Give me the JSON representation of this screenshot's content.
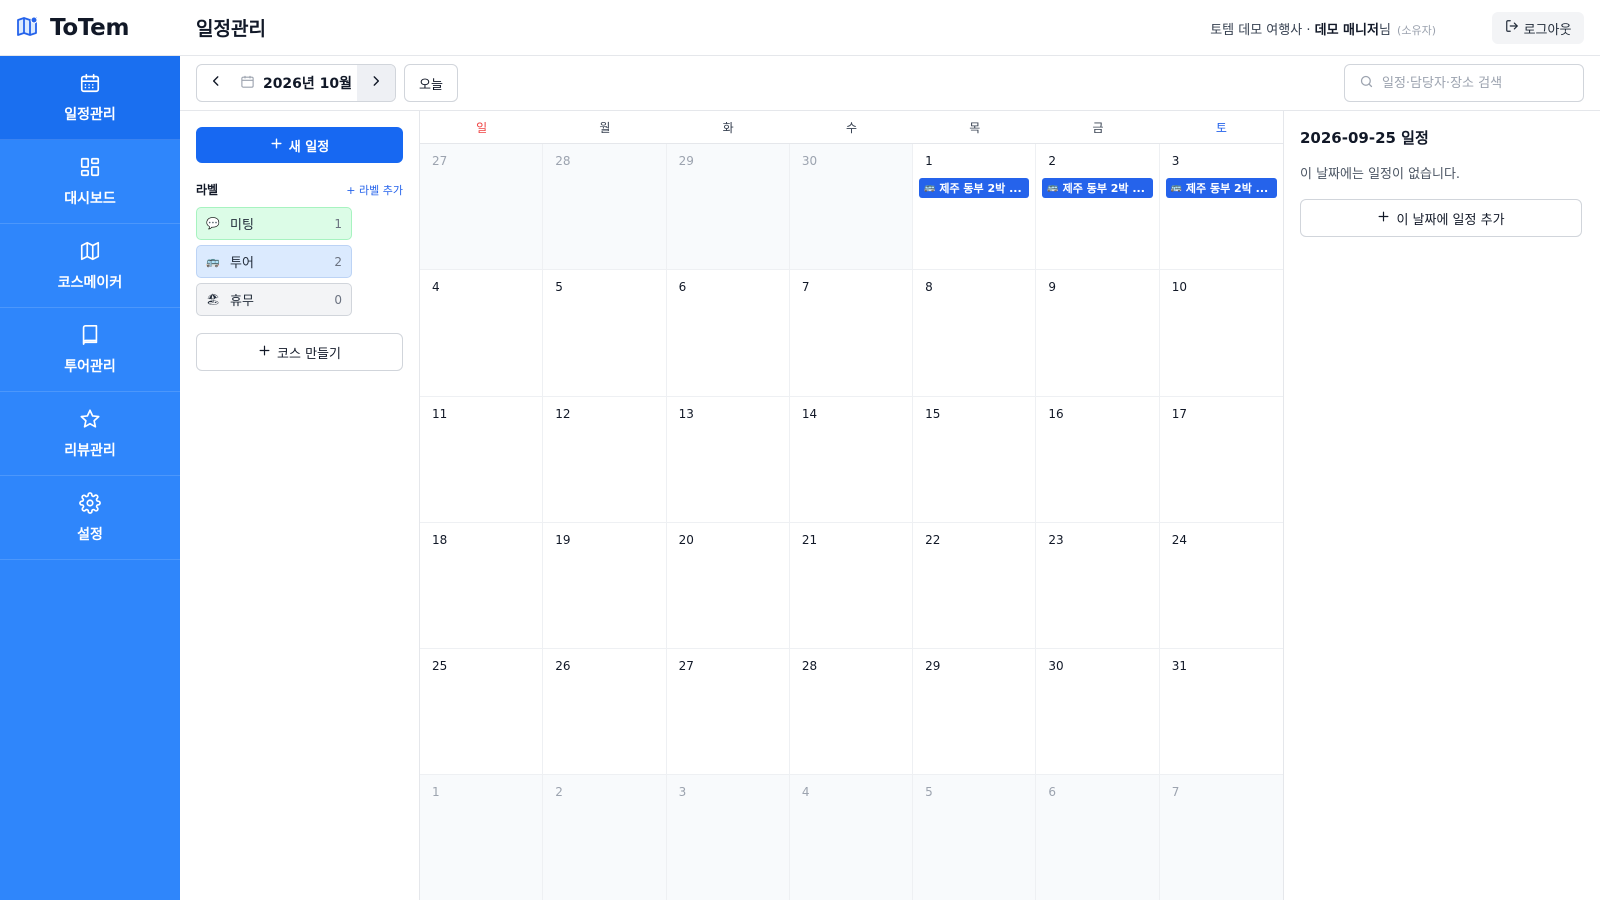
{
  "app": {
    "name": "ToTem"
  },
  "header": {
    "page_title": "일정관리",
    "company": "토템 데모 여행사",
    "separator": " · ",
    "user_name": "데모 매니저",
    "honorific": "님",
    "role": "(소유자)",
    "logout_label": "로그아웃"
  },
  "sidebar": {
    "items": [
      {
        "label": "일정관리",
        "icon": "calendar-icon",
        "active": true
      },
      {
        "label": "대시보드",
        "icon": "dashboard-icon",
        "active": false
      },
      {
        "label": "코스메이커",
        "icon": "map-icon",
        "active": false
      },
      {
        "label": "투어관리",
        "icon": "book-icon",
        "active": false
      },
      {
        "label": "리뷰관리",
        "icon": "star-icon",
        "active": false
      },
      {
        "label": "설정",
        "icon": "gear-icon",
        "active": false
      }
    ]
  },
  "toolbar": {
    "month_label": "2026년 10월",
    "today_label": "오늘",
    "search_placeholder": "일정·담당자·장소 검색"
  },
  "left_panel": {
    "new_event_label": "새 일정",
    "labels_title": "라벨",
    "add_label": "+ 라벨 추가",
    "labels": [
      {
        "emoji": "💬",
        "name": "미팅",
        "count": "1",
        "bg": "#dcfce7",
        "border": "#a7f3c0"
      },
      {
        "emoji": "🚌",
        "name": "투어",
        "count": "2",
        "bg": "#dbeafe",
        "border": "#bcd3f5"
      },
      {
        "emoji": "🏖",
        "name": "휴무",
        "count": "0",
        "bg": "#f3f4f6",
        "border": "#d1d5db"
      }
    ],
    "course_button_label": "코스 만들기"
  },
  "calendar": {
    "weekdays": [
      "일",
      "월",
      "화",
      "수",
      "목",
      "금",
      "토"
    ],
    "days": [
      {
        "n": "27",
        "other": true
      },
      {
        "n": "28",
        "other": true
      },
      {
        "n": "29",
        "other": true
      },
      {
        "n": "30",
        "other": true
      },
      {
        "n": "1",
        "event": {
          "emoji": "🚌",
          "title": "제주 동부 2박 ..."
        }
      },
      {
        "n": "2",
        "event": {
          "emoji": "🚌",
          "title": "제주 동부 2박 ..."
        }
      },
      {
        "n": "3",
        "event": {
          "emoji": "🚌",
          "title": "제주 동부 2박 ..."
        }
      },
      {
        "n": "4"
      },
      {
        "n": "5"
      },
      {
        "n": "6"
      },
      {
        "n": "7"
      },
      {
        "n": "8"
      },
      {
        "n": "9"
      },
      {
        "n": "10"
      },
      {
        "n": "11"
      },
      {
        "n": "12"
      },
      {
        "n": "13"
      },
      {
        "n": "14"
      },
      {
        "n": "15"
      },
      {
        "n": "16"
      },
      {
        "n": "17"
      },
      {
        "n": "18"
      },
      {
        "n": "19"
      },
      {
        "n": "20"
      },
      {
        "n": "21"
      },
      {
        "n": "22"
      },
      {
        "n": "23"
      },
      {
        "n": "24"
      },
      {
        "n": "25"
      },
      {
        "n": "26"
      },
      {
        "n": "27"
      },
      {
        "n": "28"
      },
      {
        "n": "29"
      },
      {
        "n": "30"
      },
      {
        "n": "31"
      },
      {
        "n": "1",
        "other": true
      },
      {
        "n": "2",
        "other": true
      },
      {
        "n": "3",
        "other": true
      },
      {
        "n": "4",
        "other": true
      },
      {
        "n": "5",
        "other": true
      },
      {
        "n": "6",
        "other": true
      },
      {
        "n": "7",
        "other": true
      }
    ]
  },
  "detail": {
    "title": "2026-09-25 일정",
    "empty_text": "이 날짜에는 일정이 없습니다.",
    "add_label": "이 날짜에 일정 추가"
  },
  "colors": {
    "sidebar": "#2f86fb",
    "sidebar_active": "#1a6ff0",
    "primary": "#1768f2",
    "event_chip": "#2563eb",
    "sunday": "#ef4444",
    "saturday": "#2563eb"
  }
}
